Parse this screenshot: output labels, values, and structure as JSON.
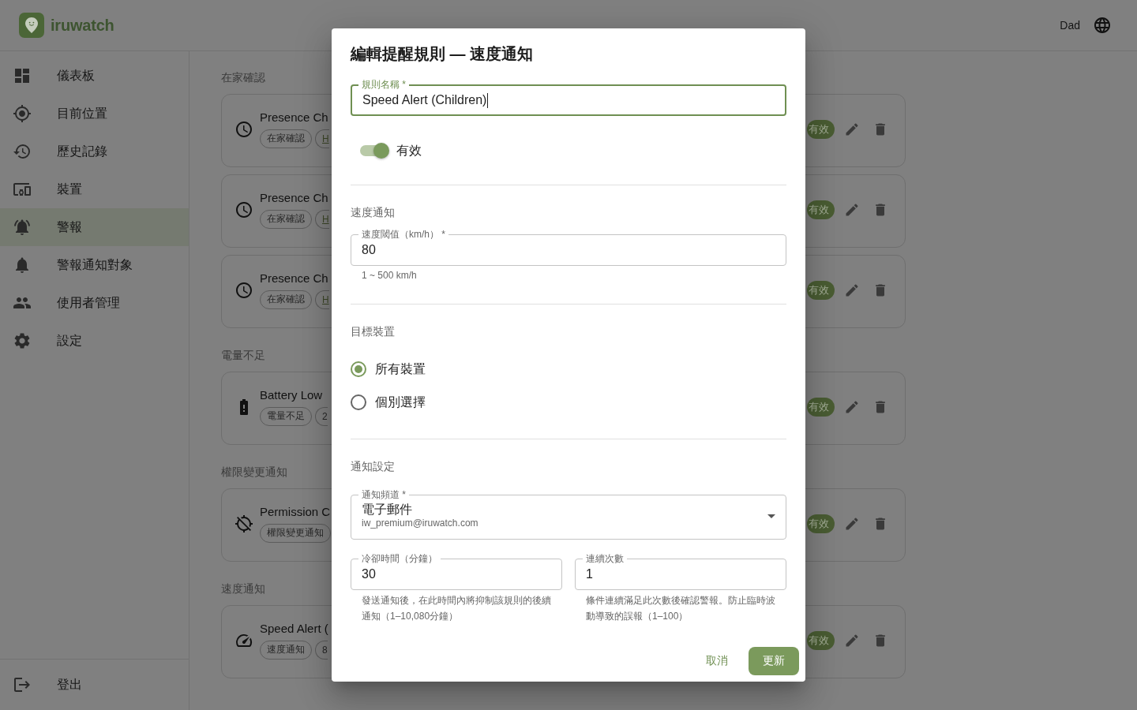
{
  "app_bar": {
    "brand": "iruwatch",
    "user": "Dad"
  },
  "sidebar": {
    "items": [
      {
        "label": "儀表板",
        "selected": false
      },
      {
        "label": "目前位置",
        "selected": false
      },
      {
        "label": "歷史記錄",
        "selected": false
      },
      {
        "label": "裝置",
        "selected": false
      },
      {
        "label": "警報",
        "selected": true
      },
      {
        "label": "警報通知對象",
        "selected": false
      },
      {
        "label": "使用者管理",
        "selected": false
      },
      {
        "label": "設定",
        "selected": false
      }
    ],
    "logout": "登出"
  },
  "rule_groups": [
    {
      "title": "在家確認",
      "rules": [
        {
          "name": "Presence Ch",
          "tags": [
            {
              "text": "在家確認",
              "kind": "plain",
              "cut": false
            },
            {
              "text": "H",
              "kind": "link",
              "cut": true
            }
          ],
          "status": "有效",
          "enabled": true
        },
        {
          "name": "Presence Ch",
          "tags": [
            {
              "text": "在家確認",
              "kind": "plain",
              "cut": false
            },
            {
              "text": "H",
              "kind": "link",
              "cut": true
            }
          ],
          "status": "有效",
          "enabled": true
        },
        {
          "name": "Presence Ch",
          "tags": [
            {
              "text": "在家確認",
              "kind": "plain",
              "cut": false
            },
            {
              "text": "H",
              "kind": "link",
              "cut": true
            }
          ],
          "status": "有效",
          "enabled": true
        }
      ]
    },
    {
      "title": "電量不足",
      "rules": [
        {
          "name": "Battery Low",
          "tags": [
            {
              "text": "電量不足",
              "kind": "plain",
              "cut": false
            },
            {
              "text": "2",
              "kind": "plain",
              "cut": true
            }
          ],
          "status": "有效",
          "enabled": true
        }
      ]
    },
    {
      "title": "權限變更通知",
      "rules": [
        {
          "name": "Permission C",
          "tags": [
            {
              "text": "權限變更通知",
              "kind": "plain",
              "cut": false
            }
          ],
          "status": "有效",
          "enabled": true
        }
      ]
    },
    {
      "title": "速度通知",
      "rules": [
        {
          "name": "Speed Alert (",
          "tags": [
            {
              "text": "速度通知",
              "kind": "plain",
              "cut": false
            },
            {
              "text": "8",
              "kind": "plain",
              "cut": true
            }
          ],
          "status": "有效",
          "enabled": true
        }
      ]
    }
  ],
  "dialog": {
    "title": "編輯提醒規則 — 速度通知",
    "rule_name": {
      "label": "規則名稱 *",
      "value": "Speed Alert (Children)",
      "focused": true
    },
    "enabled_switch": {
      "label": "有效",
      "on": true
    },
    "speed_section": {
      "title": "速度通知",
      "threshold": {
        "label": "速度閾值（km/h） *",
        "value": "80",
        "helper": "1 ~ 500 km/h"
      }
    },
    "target_section": {
      "title": "目標裝置",
      "options": [
        {
          "label": "所有裝置",
          "selected": true
        },
        {
          "label": "個別選擇",
          "selected": false
        }
      ]
    },
    "notify_section": {
      "title": "通知設定",
      "channel": {
        "label": "通知頻道 *",
        "value": "電子郵件",
        "detail": "iw_premium@iruwatch.com"
      },
      "cooldown": {
        "label": "冷卻時間（分鐘）",
        "value": "30",
        "helper": "發送通知後，在此時間內將抑制該規則的後續通知（1–10,080分鐘）"
      },
      "consecutive": {
        "label": "連續次數",
        "value": "1",
        "helper": "條件連續滿足此次數後確認警報。防止臨時波動導致的誤報（1–100）"
      }
    },
    "buttons": {
      "cancel": "取消",
      "submit": "更新"
    }
  }
}
